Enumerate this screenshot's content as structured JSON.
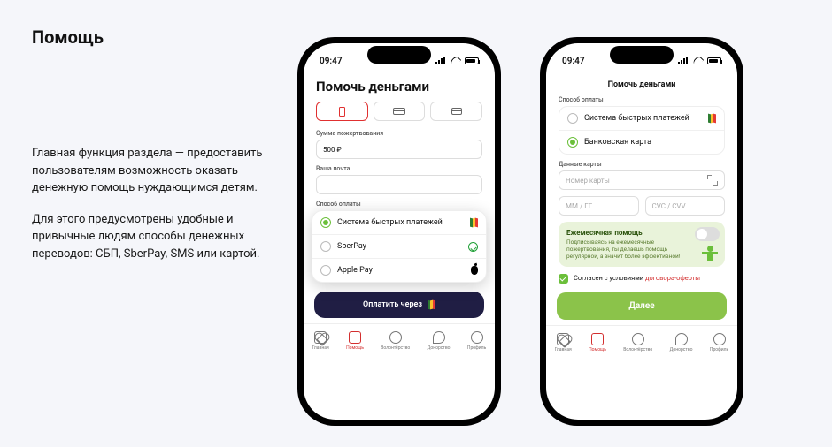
{
  "page": {
    "title": "Помощь",
    "description1": "Главная функция раздела — предоставить пользователям возможность оказать денежную помощь нуждающимся детям.",
    "description2": "Для этого предусмотрены удобные и привычные людям способы денежных переводов: СБП, SberPay, SMS или картой."
  },
  "status": {
    "time": "09:47"
  },
  "phone1": {
    "title": "Помочь деньгами",
    "amount_label": "Сумма пожертвования",
    "amount_value": "500 ₽",
    "email_label": "Ваша почта",
    "payment_label": "Способ оплаты",
    "options": {
      "sbp": "Система быстрых платежей",
      "sber": "SberPay",
      "apple": "Apple Pay"
    },
    "pay_button": "Оплатить через"
  },
  "phone2": {
    "nav_title": "Помочь деньгами",
    "payment_label": "Способ оплаты",
    "options": {
      "sbp": "Система быстрых платежей",
      "card": "Банковская карта"
    },
    "card_section": "Данные карты",
    "card_number_ph": "Номер карты",
    "expiry_ph": "ММ / ГГ",
    "cvv_ph": "CVC / CVV",
    "promo": {
      "title": "Ежемесячная помощь",
      "text": "Подписываясь на ежемесячные пожертвования, ты делаешь помощь регулярной, а значит более эффективной!"
    },
    "consent": {
      "text": "Согласен с условиями ",
      "link": "договора-оферты"
    },
    "next_button": "Далее"
  },
  "tabs": {
    "t1": "Главная",
    "t2": "Помощь",
    "t3": "Волонтёрство",
    "t4": "Донорство",
    "t5": "Профиль"
  }
}
